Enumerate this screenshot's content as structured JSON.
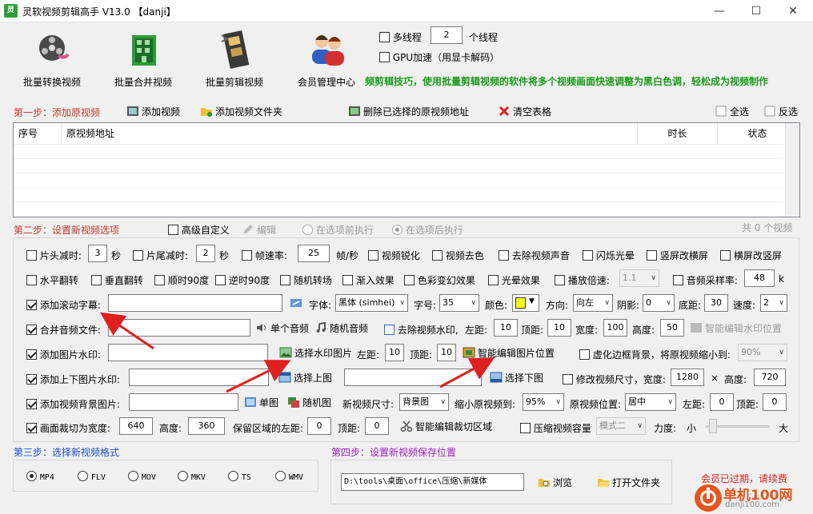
{
  "window": {
    "title": "灵软视频剪辑高手 V13.0 【danji】",
    "icon_text": "灵"
  },
  "toolbar": [
    {
      "label": "批量转换视频",
      "icon": "film-reel-icon"
    },
    {
      "label": "批量合并视频",
      "icon": "building-film-icon"
    },
    {
      "label": "批量剪辑视频",
      "icon": "film-strip-icon"
    },
    {
      "label": "会员管理中心",
      "icon": "users-icon"
    }
  ],
  "options": {
    "multithread_label": "多线程",
    "threads": "2",
    "threads_unit": "个线程",
    "gpu_label": "GPU加速（用显卡解码）"
  },
  "marquee": "频剪辑技巧，使用批量剪辑视频的软件将多个视频画面快速调整为黑白色调，轻松成为视频制作",
  "step1": {
    "title": "第一步：添加原视频",
    "add_video": "添加视频",
    "add_folder": "添加视频文件夹",
    "remove_selected": "删除已选择的原视频地址",
    "clear_table": "清空表格",
    "select_all": "全选",
    "invert": "反选",
    "columns": [
      "序号",
      "原视频地址",
      "时长",
      "状态"
    ]
  },
  "step2": {
    "title": "第二步：设置新视频选项",
    "advanced": "高级自定义",
    "edit": "编辑",
    "before": "在选项前执行",
    "after": "在选项后执行",
    "count": "共 0 个视频",
    "row1": {
      "head_cut": "片头减时:",
      "head_val": "3",
      "sec1": "秒",
      "tail_cut": "片尾减时:",
      "tail_val": "2",
      "sec2": "秒",
      "fps": "帧速率:",
      "fps_val": "25",
      "fps_unit": "帧/秒",
      "sharpen": "视频锐化",
      "decolor": "视频去色",
      "mute": "去除视频声音",
      "flash": "闪烁光晕",
      "v2h": "竖屏改横屏",
      "h2v": "横屏改竖屏"
    },
    "row2": {
      "hflip": "水平翻转",
      "vflip": "垂直翻转",
      "cw90": "顺时90度",
      "ccw90": "逆时90度",
      "random_trans": "随机转场",
      "fade": "渐入效果",
      "color_change": "色彩变幻效果",
      "halo": "光晕效果",
      "speed": "播放倍速:",
      "speed_val": "1.1",
      "sample": "音频采样率:",
      "sample_val": "48",
      "sample_unit": "k"
    },
    "row3": {
      "subtitle": "添加滚动字幕:",
      "font": "字体:",
      "font_val": "黑体 (simhei)",
      "size": "字号:",
      "size_val": "35",
      "color": "颜色:",
      "direction": "方向:",
      "direction_val": "向左",
      "shadow": "阴影:",
      "shadow_val": "0",
      "bottom": "底距:",
      "bottom_val": "30",
      "speed": "速度:",
      "speed_val": "2"
    },
    "row4": {
      "merge_audio": "合并音频文件:",
      "single_audio": "单个音频",
      "random_audio": "随机音频",
      "remove_wm": "去除视频水印,",
      "left": "左距:",
      "left_val": "10",
      "top": "顶距:",
      "top_val": "10",
      "width": "宽度:",
      "width_val": "100",
      "height": "高度:",
      "height_val": "50",
      "smart_wm": "智能编辑水印位置"
    },
    "row5": {
      "image_wm": "添加图片水印:",
      "choose_wm": "选择水印图片",
      "left": "左距:",
      "left_val": "10",
      "top": "顶距:",
      "top_val": "10",
      "smart_img": "智能编辑图片位置",
      "blur_border": "虚化边框背景，将原视频缩小到:",
      "blur_val": "90%"
    },
    "row6": {
      "updown": "添加上下图片水印:",
      "choose_up": "选择上图",
      "choose_down": "选择下图",
      "resize": "修改视频尺寸，宽度:",
      "width_val": "1280",
      "x": "×",
      "height": "高度:",
      "height_val": "720"
    },
    "row7": {
      "bg_image": "添加视频背景图片:",
      "single": "单图",
      "random": "随机图",
      "new_size": "新视频尺寸:",
      "new_size_val": "背景图",
      "shrink": "缩小原视频到:",
      "shrink_val": "95%",
      "pos": "原视频位置:",
      "pos_val": "居中",
      "left": "左距:",
      "left_val": "0",
      "top": "顶距:",
      "top_val": "0"
    },
    "row8": {
      "crop": "画面裁切为宽度:",
      "crop_w": "640",
      "height": "高度:",
      "crop_h": "360",
      "keep_left": "保留区域的左距:",
      "keep_left_val": "0",
      "top": "顶距:",
      "top_val": "0",
      "smart_crop": "智能编辑裁切区域",
      "compress": "压缩视频容量",
      "mode_val": "模式二",
      "strength": "力度:",
      "small": "小",
      "large": "大"
    }
  },
  "step3": {
    "title": "第三步：选择新视频格式",
    "formats": [
      "MP4",
      "FLV",
      "MOV",
      "MKV",
      "TS",
      "WMV"
    ]
  },
  "step4": {
    "title": "第四步：设置新视频保存位置",
    "path": "D:\\tools\\桌面\\office\\压缩\\新媒体",
    "browse": "浏览",
    "open_folder": "打开文件夹"
  },
  "status": {
    "expired": "会员已过期，请续费"
  },
  "watermark": {
    "text": "单机100网",
    "url": "danji100.com"
  },
  "colors": {
    "step_red": "#c0392b",
    "step_blue": "#1a4fc7",
    "step_purple": "#a020c0",
    "marquee_green": "#1a9a1a",
    "arrow_red": "#e02020",
    "swatch_yellow": "#ffff00"
  }
}
